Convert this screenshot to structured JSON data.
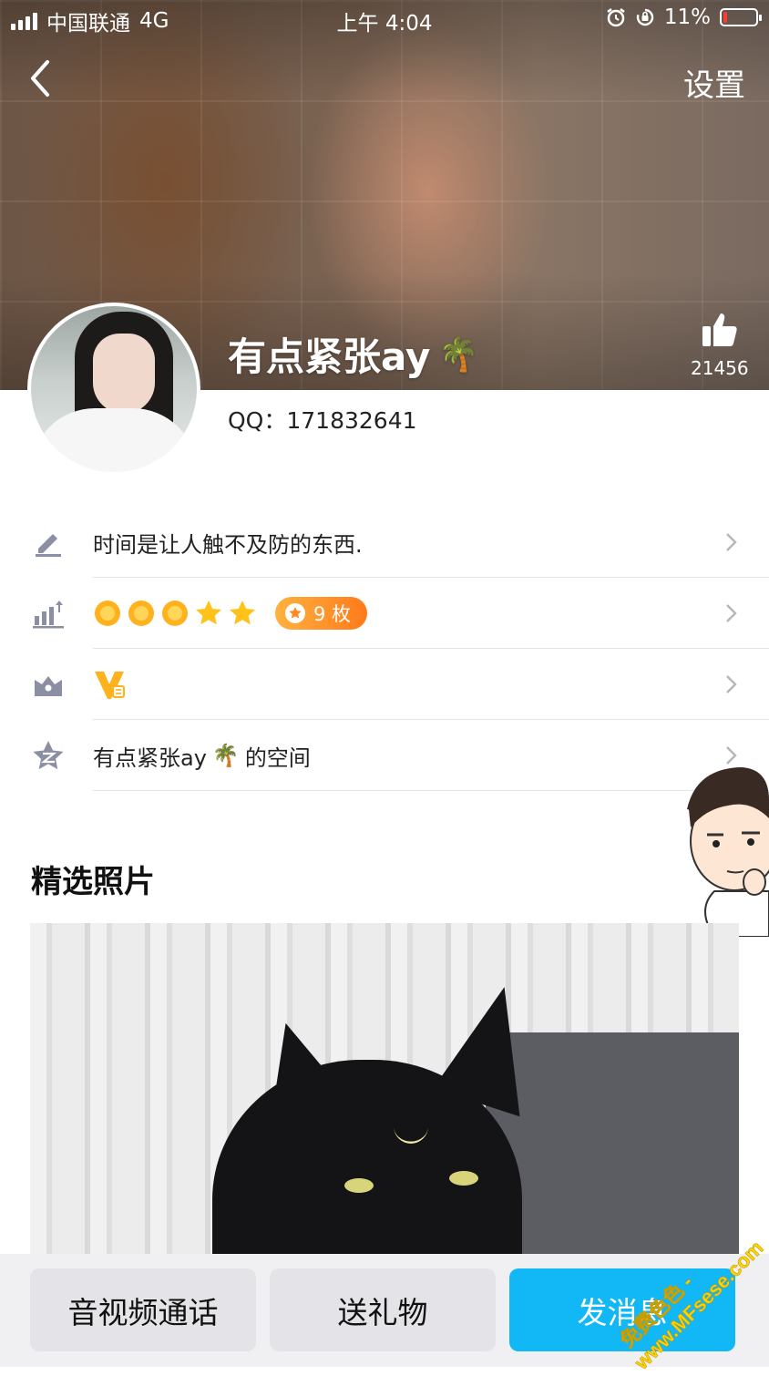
{
  "status_bar": {
    "carrier": "中国联通",
    "network": "4G",
    "time": "上午 4:04",
    "battery": "11%",
    "battery_level": 0.11
  },
  "nav": {
    "settings_label": "设置",
    "back_icon": "chevron-left-icon"
  },
  "profile": {
    "nickname": "有点紧张ay",
    "nickname_emoji": "🌴",
    "like_count": "21456",
    "qq": "QQ：171832641"
  },
  "info_rows": [
    {
      "icon": "edit-icon",
      "text": "时间是让人触不及防的东西."
    },
    {
      "icon": "level-chart-icon",
      "badge": "9 枚",
      "level_icons": [
        "sun",
        "sun",
        "sun",
        "star",
        "star"
      ]
    },
    {
      "icon": "crown-icon",
      "vip_icon": "vip-badge-icon"
    },
    {
      "icon": "qzone-star-icon",
      "text_prefix": "有点紧张ay",
      "text_emoji": "🌴",
      "text_suffix": "的空间"
    }
  ],
  "featured": {
    "title": "精选照片"
  },
  "bottom_bar": {
    "call_label": "音视频通话",
    "gift_label": "送礼物",
    "message_label": "发消息"
  },
  "watermark": {
    "line1": "免费色色 -",
    "line2": "www.MFsese.com"
  },
  "colors": {
    "primary": "#12b7f5",
    "badge": "#ff8a1f",
    "icon_gray": "#8a8fa3"
  }
}
